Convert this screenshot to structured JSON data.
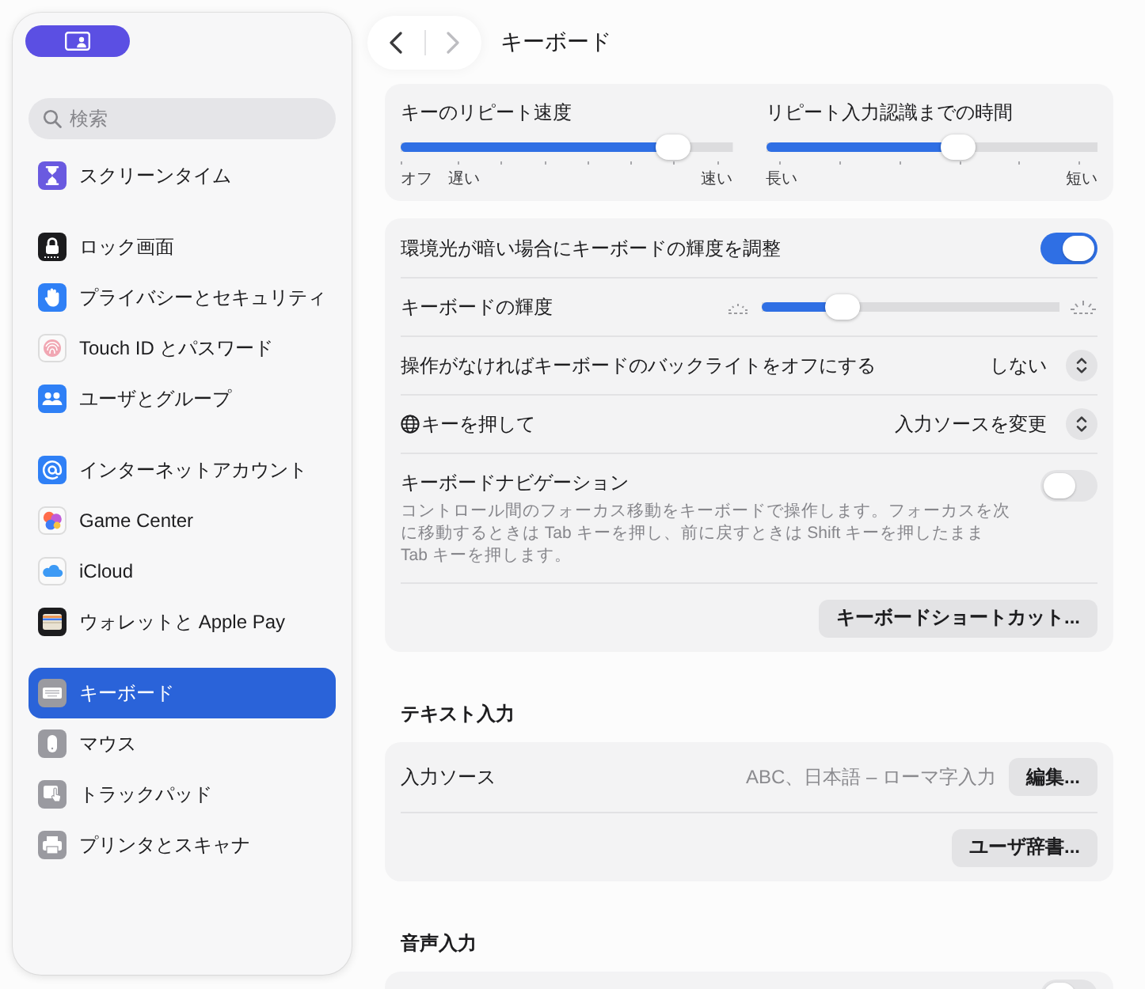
{
  "window": {
    "title": "キーボード"
  },
  "navigation": {
    "back": {
      "disabled": false
    },
    "forward": {
      "disabled": true
    }
  },
  "sidebar": {
    "search": {
      "placeholder": "検索"
    },
    "groups": [
      {
        "items": [
          {
            "label": "スクリーンタイム",
            "selected": false
          }
        ]
      },
      {
        "items": [
          {
            "label": "ロック画面",
            "selected": false
          },
          {
            "label": "プライバシーとセキュリティ",
            "selected": false
          },
          {
            "label": "Touch ID とパスワード",
            "selected": false
          },
          {
            "label": "ユーザとグループ",
            "selected": false
          }
        ]
      },
      {
        "items": [
          {
            "label": "インターネットアカウント",
            "selected": false
          },
          {
            "label": "Game Center",
            "selected": false
          },
          {
            "label": "iCloud",
            "selected": false
          },
          {
            "label": "ウォレットと Apple Pay",
            "selected": false
          }
        ]
      },
      {
        "items": [
          {
            "label": "キーボード",
            "selected": true
          },
          {
            "label": "マウス",
            "selected": false
          },
          {
            "label": "トラックパッド",
            "selected": false
          },
          {
            "label": "プリンタとスキャナ",
            "selected": false
          }
        ]
      }
    ]
  },
  "repeat_card": {
    "sliders": [
      {
        "label": "キーのリピート速度",
        "level": 0.82,
        "left_labels": [
          "オフ",
          "遅い"
        ],
        "right_label": "速い"
      },
      {
        "label": "リピート入力認識までの時間",
        "level": 0.58,
        "left_labels": [
          "長い"
        ],
        "right_label": "短い"
      }
    ]
  },
  "keyboard_card": {
    "rows": [
      {
        "kind": "toggle",
        "label": "環境光が暗い場合にキーボードの輝度を調整",
        "on": true
      },
      {
        "kind": "slider",
        "label": "キーボードの輝度",
        "level": 0.27
      },
      {
        "kind": "popup",
        "label": "操作がなければキーボードのバックライトをオフにする",
        "value": "しない"
      },
      {
        "kind": "globe_popup",
        "label": "キーを押して",
        "value": "入力ソースを変更"
      },
      {
        "kind": "toggle",
        "label": "キーボードナビゲーション",
        "on": false,
        "description": "コントロール間のフォーカス移動をキーボードで操作します。フォーカスを次に移動するときは Tab キーを押し、前に戻すときは Shift キーを押したまま Tab キーを押します。"
      },
      {
        "kind": "button",
        "label": "キーボードショートカット..."
      }
    ]
  },
  "text_input": {
    "heading": "テキスト入力",
    "rows": [
      {
        "kind": "value_button",
        "label": "入力ソース",
        "value": "ABC、日本語 – ローマ字入力",
        "button": "編集..."
      },
      {
        "kind": "button",
        "label": "ユーザ辞書..."
      }
    ]
  },
  "voice_input": {
    "heading": "音声入力",
    "rows": [
      {
        "kind": "toggle",
        "on": false
      }
    ]
  }
}
